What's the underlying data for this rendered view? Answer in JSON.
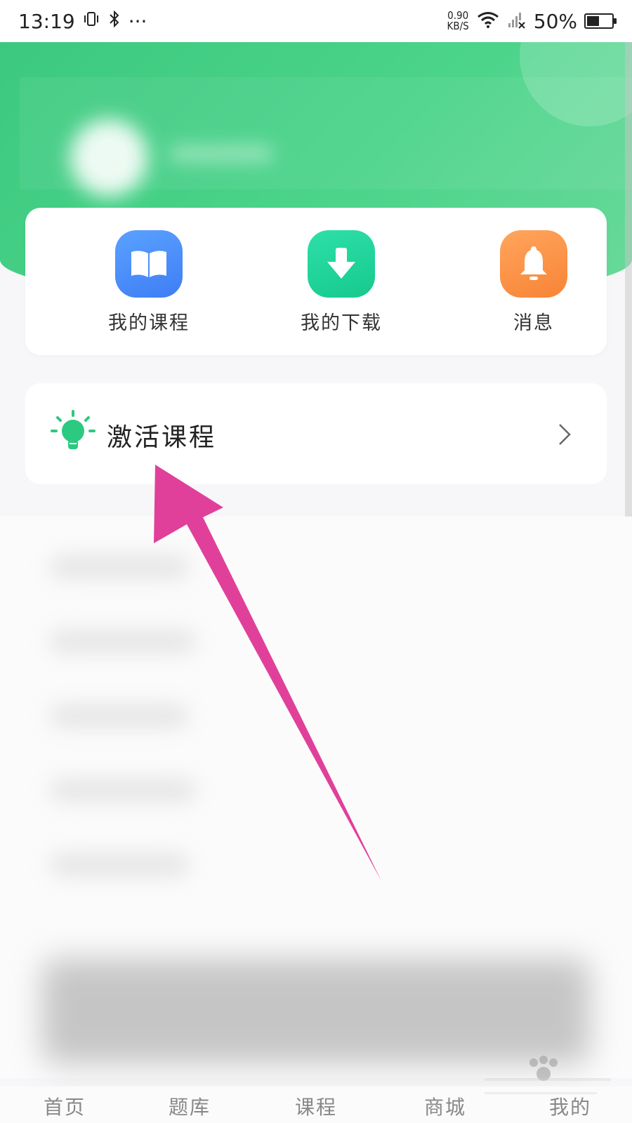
{
  "status_bar": {
    "time": "13:19",
    "dots": "···",
    "net_speed_value": "0.90",
    "net_speed_unit": "KB/S",
    "battery": "50%",
    "battery_level": 0.5
  },
  "quick_actions": [
    {
      "label": "我的课程",
      "icon": "book-icon"
    },
    {
      "label": "我的下载",
      "icon": "download-icon"
    },
    {
      "label": "消息",
      "icon": "bell-icon"
    }
  ],
  "activate_course": {
    "label": "激活课程",
    "icon": "lightbulb-icon"
  },
  "bottom_nav": [
    {
      "label": "首页"
    },
    {
      "label": "题库"
    },
    {
      "label": "课程"
    },
    {
      "label": "商城"
    },
    {
      "label": "我的"
    }
  ],
  "colors": {
    "brand_green": "#3cc97f",
    "blue_icon": "#4a8cf7",
    "green_icon": "#1fd197",
    "orange_icon": "#fb8f45",
    "annotation_arrow": "#e0409a"
  }
}
